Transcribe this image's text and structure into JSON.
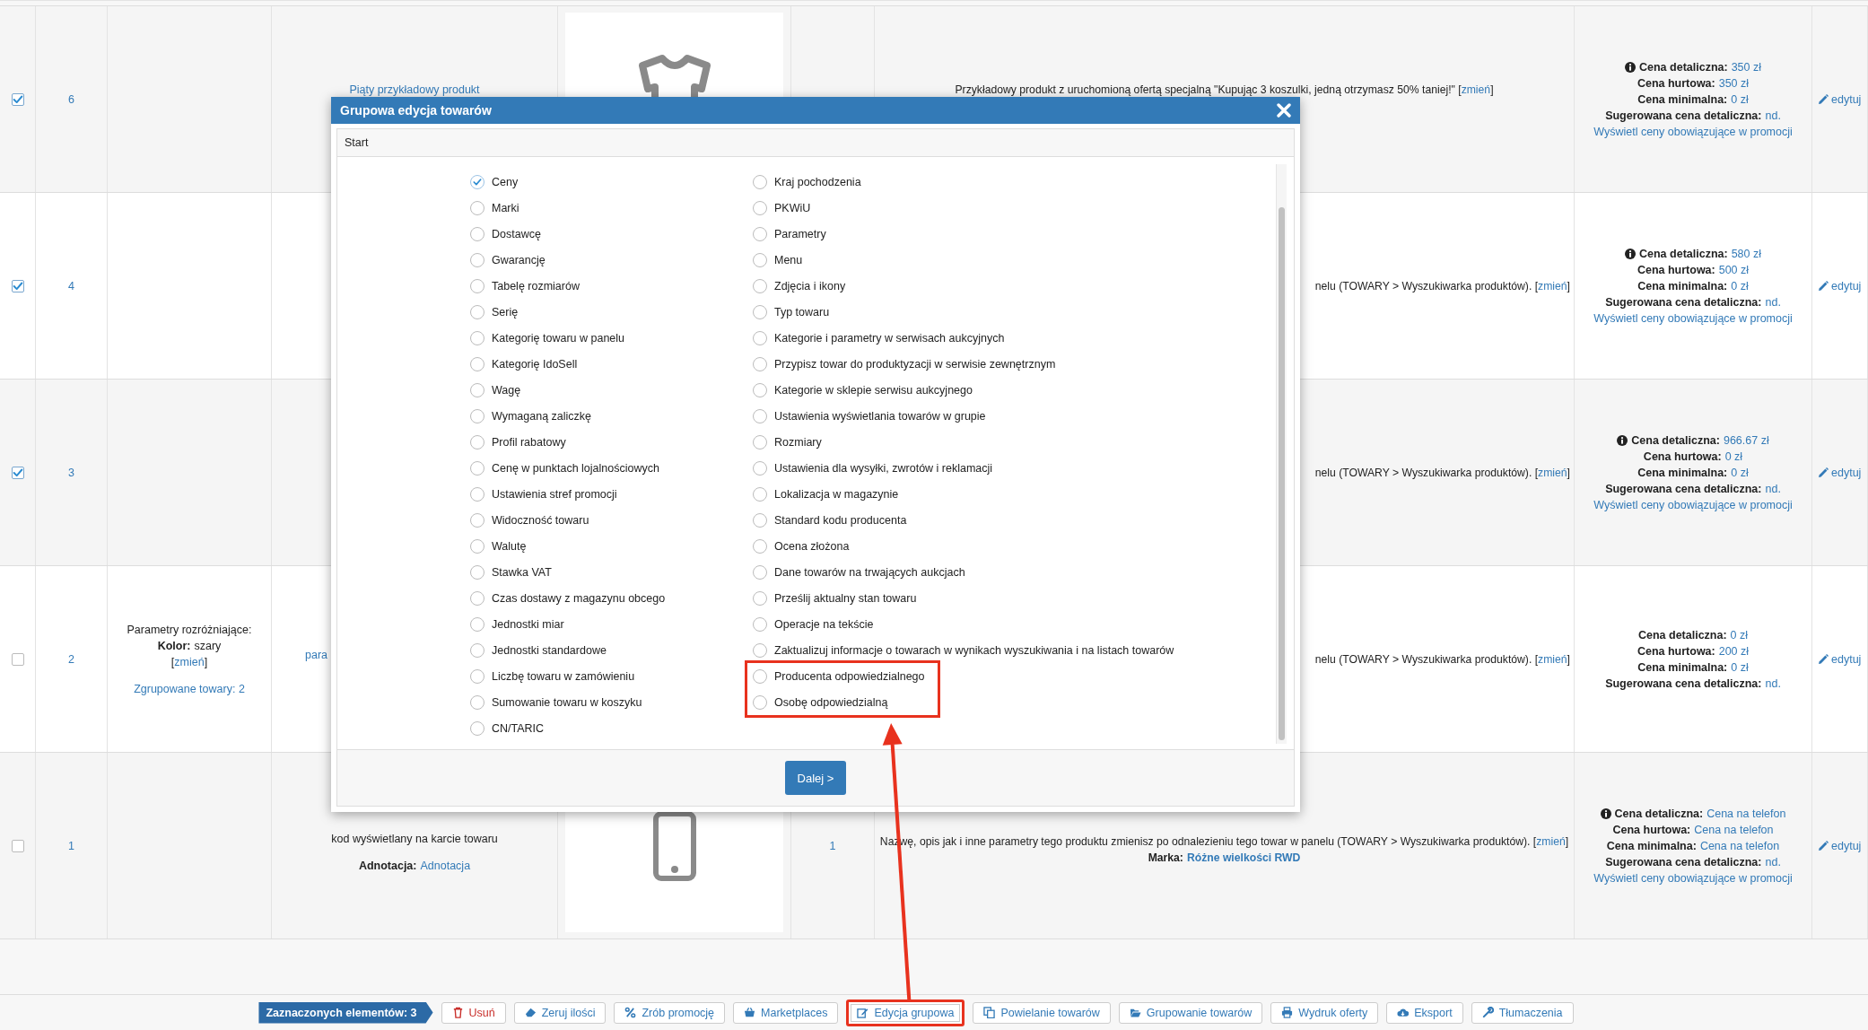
{
  "table": {
    "rows": [
      {
        "checked": true,
        "number": "6",
        "name_link": "Piąty przykładowy produkt",
        "image": {
          "kind": "shirt"
        },
        "description": {
          "before": "Przykładowy produkt z uruchomioną ofertą specjalną \"Kupując 3 koszulki, jedną otrzymasz 50% taniej!\" [",
          "link": "zmień",
          "after": "]"
        },
        "prices": [
          {
            "info": true,
            "label": "Cena detaliczna:",
            "value": "350 zł"
          },
          {
            "info": false,
            "label": "Cena hurtowa:",
            "value": "350 zł"
          },
          {
            "info": false,
            "label": "Cena minimalna:",
            "value": "0 zł"
          },
          {
            "info": false,
            "label": "Sugerowana cena detaliczna:",
            "value": "nd."
          }
        ],
        "promo_link": "Wyświetl ceny obowiązujące w promocji",
        "edit_link": "edytuj"
      },
      {
        "checked": true,
        "number": "4",
        "description": {
          "before": "nelu (TOWARY > Wyszukiwarka produktów). [",
          "link": "zmień",
          "after": "]"
        },
        "prices": [
          {
            "info": true,
            "label": "Cena detaliczna:",
            "value": "580 zł"
          },
          {
            "info": false,
            "label": "Cena hurtowa:",
            "value": "500 zł"
          },
          {
            "info": false,
            "label": "Cena minimalna:",
            "value": "0 zł"
          },
          {
            "info": false,
            "label": "Sugerowana cena detaliczna:",
            "value": "nd."
          }
        ],
        "promo_link": "Wyświetl ceny obowiązujące w promocji",
        "edit_link": "edytuj"
      },
      {
        "checked": true,
        "number": "3",
        "description": {
          "before": "nelu (TOWARY > Wyszukiwarka produktów). [",
          "link": "zmień",
          "after": "]"
        },
        "prices": [
          {
            "info": true,
            "label": "Cena detaliczna:",
            "value": "966.67 zł"
          },
          {
            "info": false,
            "label": "Cena hurtowa:",
            "value": "0 zł"
          },
          {
            "info": false,
            "label": "Cena minimalna:",
            "value": "0 zł"
          },
          {
            "info": false,
            "label": "Sugerowana cena detaliczna:",
            "value": "nd."
          }
        ],
        "promo_link": "Wyświetl ceny obowiązujące w promocji",
        "edit_link": "edytuj"
      },
      {
        "checked": false,
        "number": "2",
        "params": {
          "heading": "Parametry rozróżniające:",
          "label": "Kolor:",
          "value": "szary",
          "open": "[",
          "link": "zmień",
          "close": "]",
          "grouped_link": "Zgrupowane towary: 2"
        },
        "name_link": "para",
        "description": {
          "before": "nelu (TOWARY > Wyszukiwarka produktów). [",
          "link": "zmień",
          "after": "]"
        },
        "prices": [
          {
            "info": false,
            "label": "Cena detaliczna:",
            "value": "0 zł"
          },
          {
            "info": false,
            "label": "Cena hurtowa:",
            "value": "200 zł"
          },
          {
            "info": false,
            "label": "Cena minimalna:",
            "value": "0 zł"
          },
          {
            "info": false,
            "label": "Sugerowana cena detaliczna:",
            "value": "nd."
          }
        ],
        "edit_link": "edytuj"
      },
      {
        "checked": false,
        "number": "1",
        "name_text": "kod wyświetlany na karcie towaru",
        "annotation": {
          "label": "Adnotacja:",
          "value": "Adnotacja"
        },
        "image": {
          "kind": "phone"
        },
        "quantity": "1",
        "description": {
          "before": "Nazwę, opis jak i inne parametry tego produktu zmienisz po odnalezieniu tego towar w panelu (TOWARY > Wyszukiwarka produktów). [",
          "link": "zmień",
          "after": "]"
        },
        "brand": {
          "label": "Marka:",
          "value": "Różne wielkości RWD"
        },
        "prices": [
          {
            "info": true,
            "label": "Cena detaliczna:",
            "value": "Cena na telefon"
          },
          {
            "info": false,
            "label": "Cena hurtowa:",
            "value": "Cena na telefon"
          },
          {
            "info": false,
            "label": "Cena minimalna:",
            "value": "Cena na telefon"
          },
          {
            "info": false,
            "label": "Sugerowana cena detaliczna:",
            "value": "nd."
          }
        ],
        "promo_link": "Wyświetl ceny obowiązujące w promocji",
        "edit_link": "edytuj"
      }
    ]
  },
  "dialog": {
    "title": "Grupowa edycja towarów",
    "breadcrumb": "Start",
    "options_left": [
      {
        "label": "Ceny",
        "selected": true,
        "highlighted": false
      },
      {
        "label": "Marki",
        "selected": false,
        "highlighted": false
      },
      {
        "label": "Dostawcę",
        "selected": false,
        "highlighted": false
      },
      {
        "label": "Gwarancję",
        "selected": false,
        "highlighted": false
      },
      {
        "label": "Tabelę rozmiarów",
        "selected": false,
        "highlighted": false
      },
      {
        "label": "Serię",
        "selected": false,
        "highlighted": false
      },
      {
        "label": "Kategorię towaru w panelu",
        "selected": false,
        "highlighted": false
      },
      {
        "label": "Kategorię IdoSell",
        "selected": false,
        "highlighted": false
      },
      {
        "label": "Wagę",
        "selected": false,
        "highlighted": false
      },
      {
        "label": "Wymaganą zaliczkę",
        "selected": false,
        "highlighted": false
      },
      {
        "label": "Profil rabatowy",
        "selected": false,
        "highlighted": false
      },
      {
        "label": "Cenę w punktach lojalnościowych",
        "selected": false,
        "highlighted": false
      },
      {
        "label": "Ustawienia stref promocji",
        "selected": false,
        "highlighted": false
      },
      {
        "label": "Widoczność towaru",
        "selected": false,
        "highlighted": false
      },
      {
        "label": "Walutę",
        "selected": false,
        "highlighted": false
      },
      {
        "label": "Stawka VAT",
        "selected": false,
        "highlighted": false
      },
      {
        "label": "Czas dostawy z magazynu obcego",
        "selected": false,
        "highlighted": false
      },
      {
        "label": "Jednostki miar",
        "selected": false,
        "highlighted": false
      },
      {
        "label": "Jednostki standardowe",
        "selected": false,
        "highlighted": false
      },
      {
        "label": "Liczbę towaru w zamówieniu",
        "selected": false,
        "highlighted": false
      },
      {
        "label": "Sumowanie towaru w koszyku",
        "selected": false,
        "highlighted": false
      },
      {
        "label": "CN/TARIC",
        "selected": false,
        "highlighted": false
      }
    ],
    "options_right": [
      {
        "label": "Kraj pochodzenia",
        "selected": false,
        "highlighted": false
      },
      {
        "label": "PKWiU",
        "selected": false,
        "highlighted": false
      },
      {
        "label": "Parametry",
        "selected": false,
        "highlighted": false
      },
      {
        "label": "Menu",
        "selected": false,
        "highlighted": false
      },
      {
        "label": "Zdjęcia i ikony",
        "selected": false,
        "highlighted": false
      },
      {
        "label": "Typ towaru",
        "selected": false,
        "highlighted": false
      },
      {
        "label": "Kategorie i parametry w serwisach aukcyjnych",
        "selected": false,
        "highlighted": false
      },
      {
        "label": "Przypisz towar do produktyzacji w serwisie zewnętrznym",
        "selected": false,
        "highlighted": false
      },
      {
        "label": "Kategorie w sklepie serwisu aukcyjnego",
        "selected": false,
        "highlighted": false
      },
      {
        "label": "Ustawienia wyświetlania towarów w grupie",
        "selected": false,
        "highlighted": false
      },
      {
        "label": "Rozmiary",
        "selected": false,
        "highlighted": false
      },
      {
        "label": "Ustawienia dla wysyłki, zwrotów i reklamacji",
        "selected": false,
        "highlighted": false
      },
      {
        "label": "Lokalizacja w magazynie",
        "selected": false,
        "highlighted": false
      },
      {
        "label": "Standard kodu producenta",
        "selected": false,
        "highlighted": false
      },
      {
        "label": "Ocena złożona",
        "selected": false,
        "highlighted": false
      },
      {
        "label": "Dane towarów na trwających aukcjach",
        "selected": false,
        "highlighted": false
      },
      {
        "label": "Prześlij aktualny stan towaru",
        "selected": false,
        "highlighted": false
      },
      {
        "label": "Operacje na tekście",
        "selected": false,
        "highlighted": false
      },
      {
        "label": "Zaktualizuj informacje o towarach w wynikach wyszukiwania i na listach towarów",
        "selected": false,
        "highlighted": false
      },
      {
        "label": "Producenta odpowiedzialnego",
        "selected": false,
        "highlighted": true
      },
      {
        "label": "Osobę odpowiedzialną",
        "selected": false,
        "highlighted": true
      }
    ],
    "next_button": "Dalej >"
  },
  "toolbar": {
    "items": [
      {
        "kind": "count",
        "label": "Zaznaczonych elementów: 3",
        "highlighted": false
      },
      {
        "kind": "danger",
        "label": "Usuń",
        "highlighted": false
      },
      {
        "kind": "normal",
        "label": "Zeruj ilości",
        "highlighted": false
      },
      {
        "kind": "normal",
        "label": "Zrób promocję",
        "highlighted": false
      },
      {
        "kind": "normal",
        "label": "Marketplaces",
        "highlighted": false
      },
      {
        "kind": "normal",
        "label": "Edycja grupowa",
        "highlighted": true
      },
      {
        "kind": "normal",
        "label": "Powielanie towarów",
        "highlighted": false
      },
      {
        "kind": "normal",
        "label": "Grupowanie towarów",
        "highlighted": false
      },
      {
        "kind": "normal",
        "label": "Wydruk oferty",
        "highlighted": false
      },
      {
        "kind": "normal",
        "label": "Eksport",
        "highlighted": false
      },
      {
        "kind": "normal",
        "label": "Tłumaczenia",
        "highlighted": false
      }
    ]
  }
}
